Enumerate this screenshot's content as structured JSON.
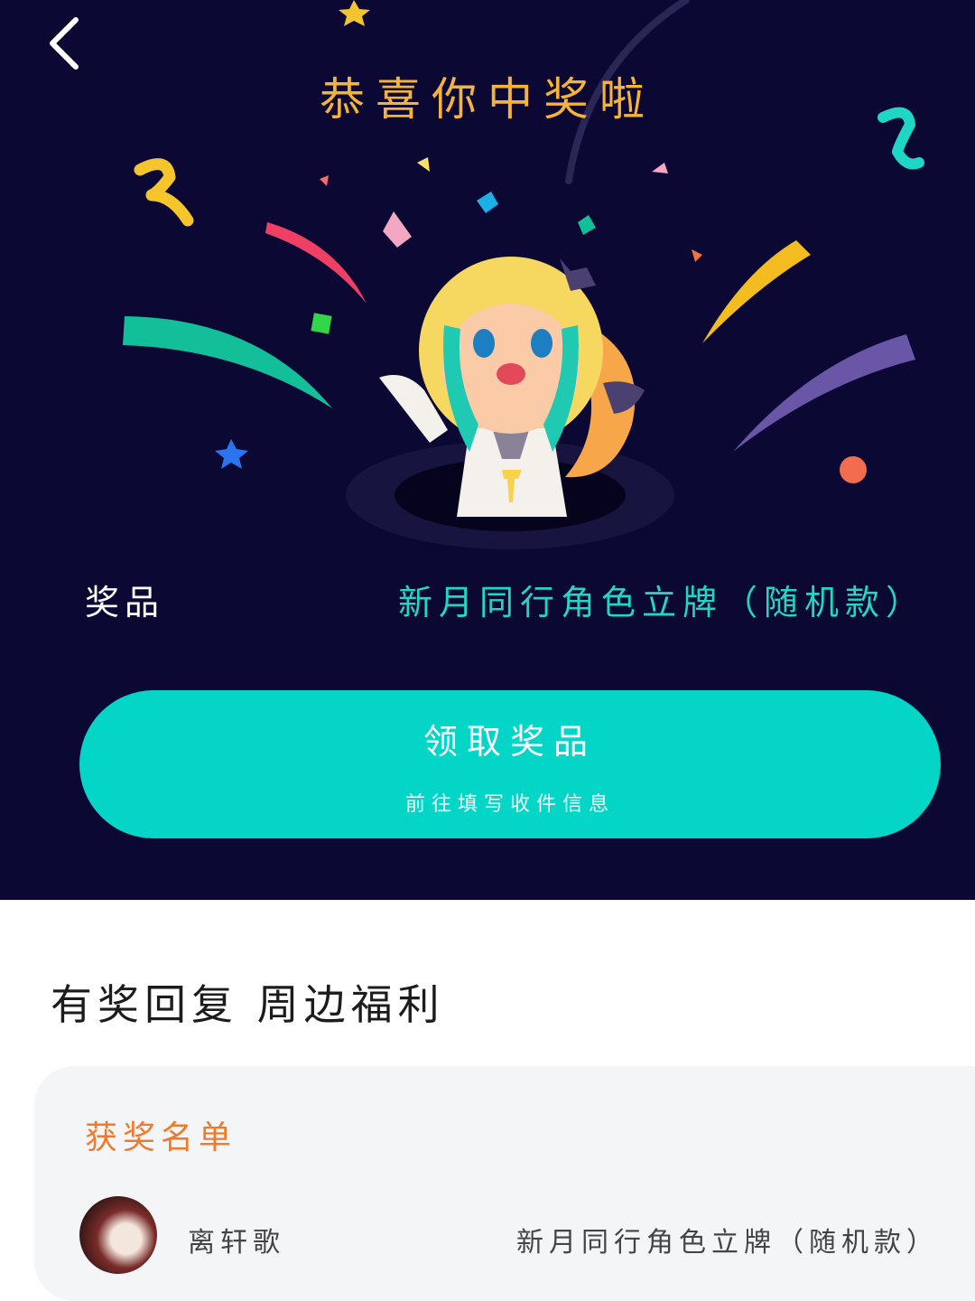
{
  "header": {
    "back_icon": "chevron-left-icon"
  },
  "celebration": {
    "headline": "恭喜你中奖啦",
    "mascot": "cheering-mascot-illustration"
  },
  "prize": {
    "label": "奖品",
    "name": "新月同行角色立牌（随机款）"
  },
  "claim_button": {
    "title": "领取奖品",
    "subtitle": "前往填写收件信息"
  },
  "section": {
    "title": "有奖回复 周边福利"
  },
  "winners_card": {
    "title": "获奖名单",
    "winners": [
      {
        "name": "离轩歌",
        "prize": "新月同行角色立牌（随机款）"
      }
    ]
  },
  "colors": {
    "background_dark": "#0b0833",
    "headline": "#f4b43a",
    "accent_teal": "#03d6c6",
    "winners_title": "#f07a2b"
  }
}
